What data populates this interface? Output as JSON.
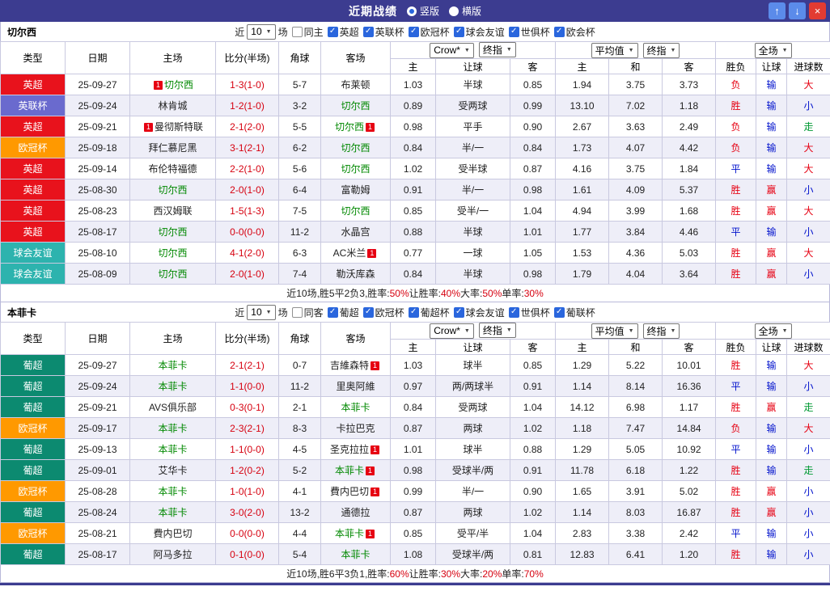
{
  "topbar": {
    "title": "近期战绩",
    "radios": [
      {
        "label": "竖版",
        "selected": true
      },
      {
        "label": "横版",
        "selected": false
      }
    ],
    "up": "↑",
    "down": "↓",
    "close": "×"
  },
  "colors": {
    "focal_team": "#008800",
    "score": "#d6000f",
    "league": {
      "英超": "#e8121c",
      "英联杯": "#6a6ace",
      "欧冠杯": "#ff9900",
      "球会友谊": "#2db3ae",
      "葡超": "#0c8a70"
    },
    "outcome": {
      "胜": "#e60012",
      "负": "#e60012",
      "平": "#0011cc",
      "赢": "#e60012",
      "输": "#0011cc",
      "大": "#e60012",
      "小": "#0011cc",
      "走": "#009933"
    }
  },
  "table_header": {
    "type": "类型",
    "date": "日期",
    "home": "主场",
    "score": "比分(半场)",
    "corner": "角球",
    "away": "客场",
    "asia_selects": [
      "Crow*",
      "终指"
    ],
    "euro_selects": [
      "平均值",
      "终指"
    ],
    "scope_select": "全场",
    "asia_cols": [
      "主",
      "让球",
      "客"
    ],
    "euro_cols": [
      "主",
      "和",
      "客"
    ],
    "outcome_cols": [
      "胜负",
      "让球",
      "进球数"
    ]
  },
  "sections": [
    {
      "team": "切尔西",
      "filter": {
        "prefix": "近",
        "count": "10",
        "suffix": "场",
        "same": {
          "label": "同主",
          "checked": false
        },
        "leagues": [
          {
            "label": "英超",
            "checked": true
          },
          {
            "label": "英联杯",
            "checked": true
          },
          {
            "label": "欧冠杯",
            "checked": true
          },
          {
            "label": "球会友谊",
            "checked": true
          },
          {
            "label": "世俱杯",
            "checked": true
          },
          {
            "label": "欧会杯",
            "checked": true
          }
        ]
      },
      "rows": [
        {
          "league": "英超",
          "date": "25-09-27",
          "home": {
            "name": "切尔西",
            "focal": true,
            "card": "1",
            "card_pos": "before"
          },
          "score": "1-3(1-0)",
          "corner": "5-7",
          "away": {
            "name": "布莱顿",
            "focal": false
          },
          "asia": [
            "1.03",
            "半球",
            "0.85"
          ],
          "euro": [
            "1.94",
            "3.75",
            "3.73"
          ],
          "outcome": [
            "负",
            "输",
            "大"
          ]
        },
        {
          "league": "英联杯",
          "date": "25-09-24",
          "home": {
            "name": "林肯城",
            "focal": false
          },
          "score": "1-2(1-0)",
          "corner": "3-2",
          "away": {
            "name": "切尔西",
            "focal": true
          },
          "asia": [
            "0.89",
            "受两球",
            "0.99"
          ],
          "euro": [
            "13.10",
            "7.02",
            "1.18"
          ],
          "outcome": [
            "胜",
            "输",
            "小"
          ]
        },
        {
          "league": "英超",
          "date": "25-09-21",
          "home": {
            "name": "曼彻斯特联",
            "focal": false,
            "card": "1",
            "card_pos": "before"
          },
          "score": "2-1(2-0)",
          "corner": "5-5",
          "away": {
            "name": "切尔西",
            "focal": true,
            "card": "1",
            "card_pos": "after"
          },
          "asia": [
            "0.98",
            "平手",
            "0.90"
          ],
          "euro": [
            "2.67",
            "3.63",
            "2.49"
          ],
          "outcome": [
            "负",
            "输",
            "走"
          ]
        },
        {
          "league": "欧冠杯",
          "date": "25-09-18",
          "home": {
            "name": "拜仁慕尼黑",
            "focal": false
          },
          "score": "3-1(2-1)",
          "corner": "6-2",
          "away": {
            "name": "切尔西",
            "focal": true
          },
          "asia": [
            "0.84",
            "半/一",
            "0.84"
          ],
          "euro": [
            "1.73",
            "4.07",
            "4.42"
          ],
          "outcome": [
            "负",
            "输",
            "大"
          ]
        },
        {
          "league": "英超",
          "date": "25-09-14",
          "home": {
            "name": "布伦特福德",
            "focal": false
          },
          "score": "2-2(1-0)",
          "corner": "5-6",
          "away": {
            "name": "切尔西",
            "focal": true
          },
          "asia": [
            "1.02",
            "受半球",
            "0.87"
          ],
          "euro": [
            "4.16",
            "3.75",
            "1.84"
          ],
          "outcome": [
            "平",
            "输",
            "大"
          ]
        },
        {
          "league": "英超",
          "date": "25-08-30",
          "home": {
            "name": "切尔西",
            "focal": true
          },
          "score": "2-0(1-0)",
          "corner": "6-4",
          "away": {
            "name": "富勒姆",
            "focal": false
          },
          "asia": [
            "0.91",
            "半/一",
            "0.98"
          ],
          "euro": [
            "1.61",
            "4.09",
            "5.37"
          ],
          "outcome": [
            "胜",
            "赢",
            "小"
          ]
        },
        {
          "league": "英超",
          "date": "25-08-23",
          "home": {
            "name": "西汉姆联",
            "focal": false
          },
          "score": "1-5(1-3)",
          "corner": "7-5",
          "away": {
            "name": "切尔西",
            "focal": true
          },
          "asia": [
            "0.85",
            "受半/一",
            "1.04"
          ],
          "euro": [
            "4.94",
            "3.99",
            "1.68"
          ],
          "outcome": [
            "胜",
            "赢",
            "大"
          ]
        },
        {
          "league": "英超",
          "date": "25-08-17",
          "home": {
            "name": "切尔西",
            "focal": true
          },
          "score": "0-0(0-0)",
          "corner": "11-2",
          "away": {
            "name": "水晶宫",
            "focal": false
          },
          "asia": [
            "0.88",
            "半球",
            "1.01"
          ],
          "euro": [
            "1.77",
            "3.84",
            "4.46"
          ],
          "outcome": [
            "平",
            "输",
            "小"
          ]
        },
        {
          "league": "球会友谊",
          "date": "25-08-10",
          "home": {
            "name": "切尔西",
            "focal": true
          },
          "score": "4-1(2-0)",
          "corner": "6-3",
          "away": {
            "name": "AC米兰",
            "focal": false,
            "card": "1",
            "card_pos": "after"
          },
          "asia": [
            "0.77",
            "一球",
            "1.05"
          ],
          "euro": [
            "1.53",
            "4.36",
            "5.03"
          ],
          "outcome": [
            "胜",
            "赢",
            "大"
          ]
        },
        {
          "league": "球会友谊",
          "date": "25-08-09",
          "home": {
            "name": "切尔西",
            "focal": true
          },
          "score": "2-0(1-0)",
          "corner": "7-4",
          "away": {
            "name": "勒沃库森",
            "focal": false
          },
          "asia": [
            "0.84",
            "半球",
            "0.98"
          ],
          "euro": [
            "1.79",
            "4.04",
            "3.64"
          ],
          "outcome": [
            "胜",
            "赢",
            "小"
          ]
        }
      ],
      "summary": [
        {
          "text": "近10场,胜5平2负3,胜率:",
          "red": false
        },
        {
          "text": "50%",
          "red": true
        },
        {
          "text": " 让胜率:",
          "red": false
        },
        {
          "text": "40%",
          "red": true
        },
        {
          "text": " 大率:",
          "red": false
        },
        {
          "text": "50%",
          "red": true
        },
        {
          "text": " 单率:",
          "red": false
        },
        {
          "text": "30%",
          "red": true
        }
      ]
    },
    {
      "team": "本菲卡",
      "filter": {
        "prefix": "近",
        "count": "10",
        "suffix": "场",
        "same": {
          "label": "同客",
          "checked": false
        },
        "leagues": [
          {
            "label": "葡超",
            "checked": true
          },
          {
            "label": "欧冠杯",
            "checked": true
          },
          {
            "label": "葡超杯",
            "checked": true
          },
          {
            "label": "球会友谊",
            "checked": true
          },
          {
            "label": "世俱杯",
            "checked": true
          },
          {
            "label": "葡联杯",
            "checked": true
          }
        ]
      },
      "rows": [
        {
          "league": "葡超",
          "date": "25-09-27",
          "home": {
            "name": "本菲卡",
            "focal": true
          },
          "score": "2-1(2-1)",
          "corner": "0-7",
          "away": {
            "name": "吉維森特",
            "focal": false,
            "card": "1",
            "card_pos": "after"
          },
          "asia": [
            "1.03",
            "球半",
            "0.85"
          ],
          "euro": [
            "1.29",
            "5.22",
            "10.01"
          ],
          "outcome": [
            "胜",
            "输",
            "大"
          ]
        },
        {
          "league": "葡超",
          "date": "25-09-24",
          "home": {
            "name": "本菲卡",
            "focal": true
          },
          "score": "1-1(0-0)",
          "corner": "11-2",
          "away": {
            "name": "里奥阿維",
            "focal": false
          },
          "asia": [
            "0.97",
            "两/两球半",
            "0.91"
          ],
          "euro": [
            "1.14",
            "8.14",
            "16.36"
          ],
          "outcome": [
            "平",
            "输",
            "小"
          ]
        },
        {
          "league": "葡超",
          "date": "25-09-21",
          "home": {
            "name": "AVS俱乐部",
            "focal": false
          },
          "score": "0-3(0-1)",
          "corner": "2-1",
          "away": {
            "name": "本菲卡",
            "focal": true
          },
          "asia": [
            "0.84",
            "受两球",
            "1.04"
          ],
          "euro": [
            "14.12",
            "6.98",
            "1.17"
          ],
          "outcome": [
            "胜",
            "赢",
            "走"
          ]
        },
        {
          "league": "欧冠杯",
          "date": "25-09-17",
          "home": {
            "name": "本菲卡",
            "focal": true
          },
          "score": "2-3(2-1)",
          "corner": "8-3",
          "away": {
            "name": "卡拉巴克",
            "focal": false
          },
          "asia": [
            "0.87",
            "两球",
            "1.02"
          ],
          "euro": [
            "1.18",
            "7.47",
            "14.84"
          ],
          "outcome": [
            "负",
            "输",
            "大"
          ]
        },
        {
          "league": "葡超",
          "date": "25-09-13",
          "home": {
            "name": "本菲卡",
            "focal": true
          },
          "score": "1-1(0-0)",
          "corner": "4-5",
          "away": {
            "name": "圣克拉拉",
            "focal": false,
            "card": "1",
            "card_pos": "after"
          },
          "asia": [
            "1.01",
            "球半",
            "0.88"
          ],
          "euro": [
            "1.29",
            "5.05",
            "10.92"
          ],
          "outcome": [
            "平",
            "输",
            "小"
          ]
        },
        {
          "league": "葡超",
          "date": "25-09-01",
          "home": {
            "name": "艾华卡",
            "focal": false
          },
          "score": "1-2(0-2)",
          "corner": "5-2",
          "away": {
            "name": "本菲卡",
            "focal": true,
            "card": "1",
            "card_pos": "after"
          },
          "asia": [
            "0.98",
            "受球半/两",
            "0.91"
          ],
          "euro": [
            "11.78",
            "6.18",
            "1.22"
          ],
          "outcome": [
            "胜",
            "输",
            "走"
          ]
        },
        {
          "league": "欧冠杯",
          "date": "25-08-28",
          "home": {
            "name": "本菲卡",
            "focal": true
          },
          "score": "1-0(1-0)",
          "corner": "4-1",
          "away": {
            "name": "費内巴切",
            "focal": false,
            "card": "1",
            "card_pos": "after"
          },
          "asia": [
            "0.99",
            "半/一",
            "0.90"
          ],
          "euro": [
            "1.65",
            "3.91",
            "5.02"
          ],
          "outcome": [
            "胜",
            "赢",
            "小"
          ]
        },
        {
          "league": "葡超",
          "date": "25-08-24",
          "home": {
            "name": "本菲卡",
            "focal": true
          },
          "score": "3-0(2-0)",
          "corner": "13-2",
          "away": {
            "name": "通德拉",
            "focal": false
          },
          "asia": [
            "0.87",
            "两球",
            "1.02"
          ],
          "euro": [
            "1.14",
            "8.03",
            "16.87"
          ],
          "outcome": [
            "胜",
            "赢",
            "小"
          ]
        },
        {
          "league": "欧冠杯",
          "date": "25-08-21",
          "home": {
            "name": "費内巴切",
            "focal": false
          },
          "score": "0-0(0-0)",
          "corner": "4-4",
          "away": {
            "name": "本菲卡",
            "focal": true,
            "card": "1",
            "card_pos": "after"
          },
          "asia": [
            "0.85",
            "受平/半",
            "1.04"
          ],
          "euro": [
            "2.83",
            "3.38",
            "2.42"
          ],
          "outcome": [
            "平",
            "输",
            "小"
          ]
        },
        {
          "league": "葡超",
          "date": "25-08-17",
          "home": {
            "name": "阿马多拉",
            "focal": false
          },
          "score": "0-1(0-0)",
          "corner": "5-4",
          "away": {
            "name": "本菲卡",
            "focal": true
          },
          "asia": [
            "1.08",
            "受球半/两",
            "0.81"
          ],
          "euro": [
            "12.83",
            "6.41",
            "1.20"
          ],
          "outcome": [
            "胜",
            "输",
            "小"
          ]
        }
      ],
      "summary": [
        {
          "text": "近10场,胜6平3负1,胜率:",
          "red": false
        },
        {
          "text": "60%",
          "red": true
        },
        {
          "text": " 让胜率:",
          "red": false
        },
        {
          "text": "30%",
          "red": true
        },
        {
          "text": " 大率:",
          "red": false
        },
        {
          "text": "20%",
          "red": true
        },
        {
          "text": " 单率:",
          "red": false
        },
        {
          "text": "70%",
          "red": true
        }
      ]
    }
  ]
}
